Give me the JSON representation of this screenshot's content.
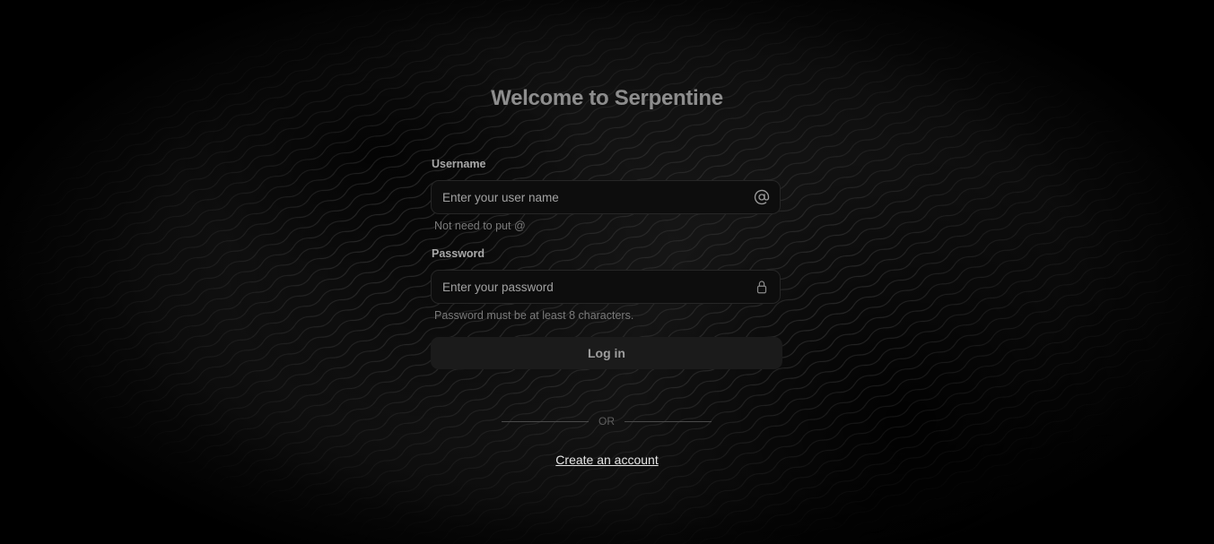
{
  "title": "Welcome to Serpentine",
  "username": {
    "label": "Username",
    "placeholder": "Enter your user name",
    "value": "",
    "icon": "at-sign-icon",
    "hint": "Not need to put @"
  },
  "password": {
    "label": "Password",
    "placeholder": "Enter your password",
    "value": "",
    "icon": "lock-icon",
    "hint": "Password must be at least 8 characters."
  },
  "login_button": "Log in",
  "divider_text": "OR",
  "create_account_link": "Create an account",
  "colors": {
    "background": "#000000",
    "title": "#8d8d8d",
    "input_background": "#0d0d0d",
    "button_background": "#1b1b1b",
    "link": "#e6e6e6"
  }
}
